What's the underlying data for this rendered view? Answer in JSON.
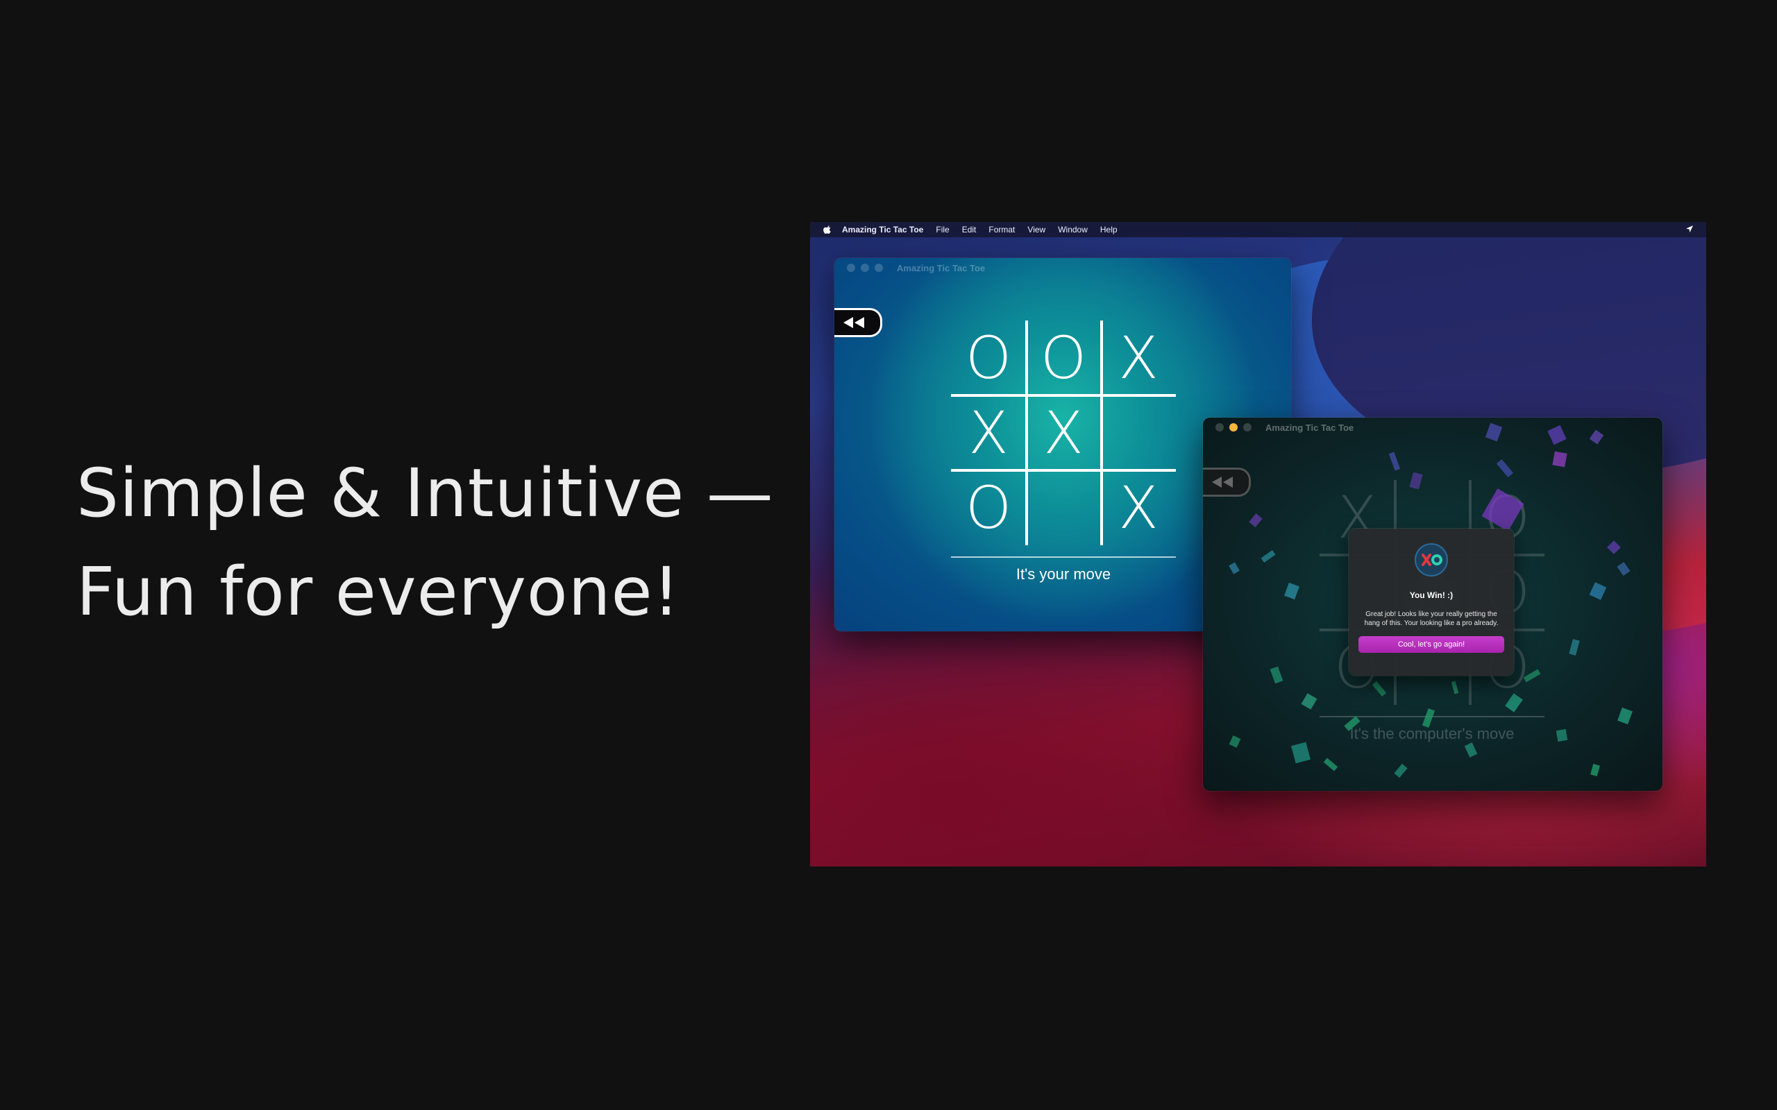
{
  "headline": {
    "line1": "Simple & Intuitive —",
    "line2": "Fun for everyone!"
  },
  "menubar": {
    "app_name": "Amazing Tic Tac Toe",
    "items": [
      "File",
      "Edit",
      "Format",
      "View",
      "Window",
      "Help"
    ]
  },
  "window_left": {
    "title": "Amazing Tic Tac Toe",
    "board": [
      "O",
      "O",
      "X",
      "X",
      "X",
      "",
      "O",
      "",
      "X"
    ],
    "status": "It's your move"
  },
  "window_right": {
    "title": "Amazing Tic Tac Toe",
    "board": [
      "X",
      "",
      "O",
      "",
      "X",
      "O",
      "O",
      "",
      "O"
    ],
    "status": "It's the computer's move",
    "dialog": {
      "title": "You Win! :)",
      "message": "Great job! Looks like your really getting the hang of this. Your looking like a pro already.",
      "button": "Cool, let's go again!"
    }
  },
  "colors": {
    "accent_button": "#b52fba",
    "traffic_yellow": "#f6b73c",
    "page_background": "#111112"
  }
}
